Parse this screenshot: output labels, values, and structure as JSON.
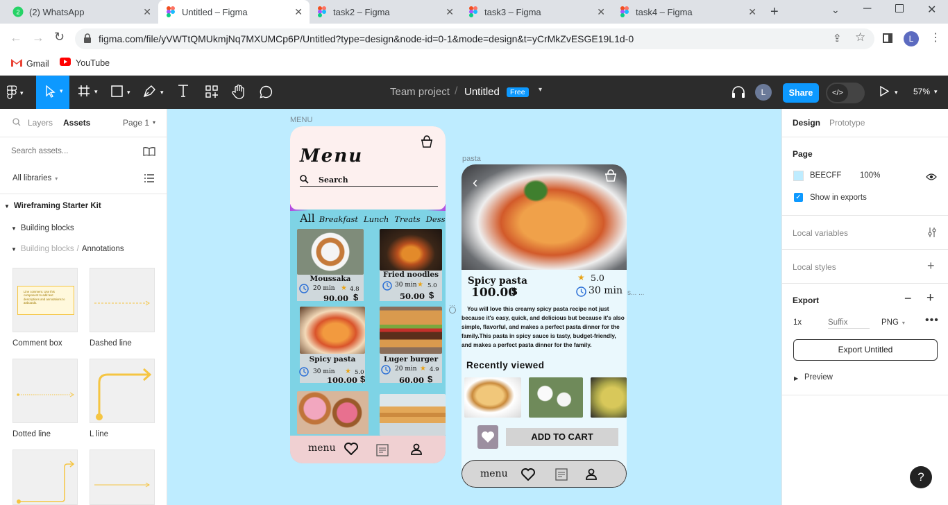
{
  "browser": {
    "tabs": [
      {
        "title": "(2) WhatsApp",
        "active": false
      },
      {
        "title": "Untitled – Figma",
        "active": true
      },
      {
        "title": "task2 – Figma",
        "active": false
      },
      {
        "title": "task3 – Figma",
        "active": false
      },
      {
        "title": "task4 – Figma",
        "active": false
      }
    ],
    "url": "figma.com/file/yVWTtQMUkmjNq7MXUMCp6P/Untitled?type=design&node-id=0-1&mode=design&t=yCrMkZvESGE19L1d-0",
    "bookmarks": [
      "Gmail",
      "YouTube"
    ],
    "profile_initial": "L"
  },
  "toolbar": {
    "team": "Team project",
    "slash": "/",
    "file": "Untitled",
    "badge": "Free",
    "user_initial": "L",
    "share": "Share",
    "zoom": "57%"
  },
  "left": {
    "tabs": {
      "layers": "Layers",
      "assets": "Assets",
      "page": "Page 1"
    },
    "search_placeholder": "Search assets...",
    "libraries": "All libraries",
    "kit": "Wireframing Starter Kit",
    "building_blocks": "Building blocks",
    "crumb_parent": "Building blocks",
    "crumb_sep": "/",
    "crumb_current": "Annotations",
    "comment_sample": "Line comment. Use this component to add text descriptions and annotations to artboards.",
    "assets": [
      "Comment box",
      "Dashed line",
      "Dotted line",
      "L line"
    ]
  },
  "right": {
    "tabs": {
      "design": "Design",
      "prototype": "Prototype"
    },
    "page_heading": "Page",
    "page_color": "BEECFF",
    "page_opacity": "100%",
    "show_in_exports": "Show in exports",
    "local_variables": "Local variables",
    "local_styles": "Local styles",
    "export_heading": "Export",
    "export_scale": "1x",
    "export_suffix_placeholder": "Suffix",
    "export_format": "PNG",
    "export_button": "Export Untitled",
    "preview": "Preview",
    "help": "?"
  },
  "canvas": {
    "frame1_label": "MENU",
    "frame2_label": "pasta",
    "menu": {
      "title": "Menu",
      "search": "Search",
      "categories": [
        "All",
        "Breakfast",
        "Lunch",
        "Treats",
        "Dessert"
      ],
      "items": [
        {
          "name": "Moussaka",
          "time": "20 min",
          "rating": "4.8",
          "price": "90.00"
        },
        {
          "name": "Fried noodles",
          "time": "30 min",
          "rating": "5.0",
          "price": "50.00"
        },
        {
          "name": "Spicy pasta",
          "time": "30 min",
          "rating": "5.0",
          "price": "100.00"
        },
        {
          "name": "Luger burger",
          "time": "20 min",
          "rating": "4.9",
          "price": "60.00"
        }
      ],
      "currency": "$",
      "nav_label": "menu"
    },
    "detail": {
      "name": "Spicy pasta",
      "price": "100.00",
      "currency": "$",
      "rating": "5.0",
      "time": "30 min",
      "description": "You will love this creamy spicy pasta recipe not just because it's easy, quick, and delicious but because it's also simple, flavorful, and makes a perfect pasta dinner for the family.This pasta in spicy sauce is tasty, budget-friendly, and makes a perfect pasta dinner for the family.",
      "recent_heading": "Recently viewed",
      "add_to_cart": "ADD TO CART",
      "nav_label": "menu",
      "stray_text": "s...   ..."
    }
  }
}
